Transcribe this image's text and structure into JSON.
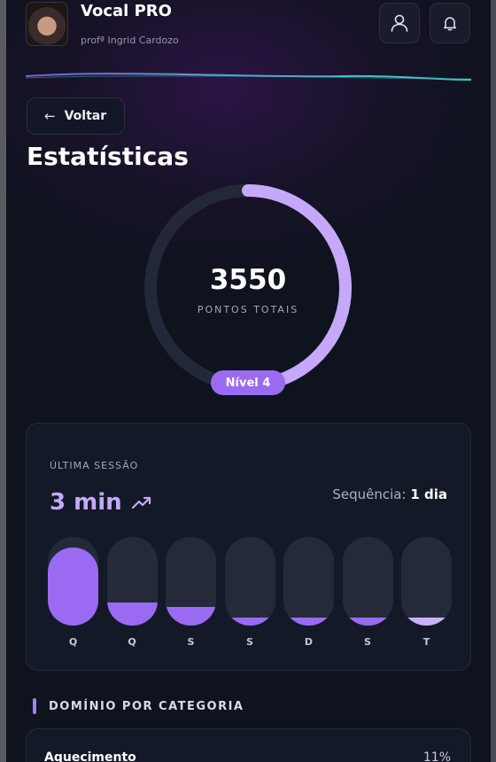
{
  "header": {
    "app_title": "Vocal PRO",
    "subtitle": "profª Ingrid Cardozo",
    "icons": [
      "profile-icon",
      "bell-icon"
    ]
  },
  "nav": {
    "back_label": "Voltar"
  },
  "page": {
    "title": "Estatísticas"
  },
  "points": {
    "value": "3550",
    "label": "PONTOS TOTAIS",
    "level": "Nível 4",
    "ring_progress": 0.46
  },
  "session": {
    "label": "ÚLTIMA SESSÃO",
    "duration": "3 min",
    "streak_label": "Sequência: ",
    "streak_value": "1 dia",
    "days": [
      {
        "label": "Q",
        "fill": 0.88
      },
      {
        "label": "Q",
        "fill": 0.26
      },
      {
        "label": "S",
        "fill": 0.21
      },
      {
        "label": "S",
        "fill": 0.09
      },
      {
        "label": "D",
        "fill": 0.09
      },
      {
        "label": "S",
        "fill": 0.09
      },
      {
        "label": "T",
        "fill": 0.09
      }
    ]
  },
  "categories": {
    "title": "DOMÍNIO POR CATEGORIA",
    "items": [
      {
        "name": "Aquecimento",
        "percent": "11%"
      }
    ]
  },
  "colors": {
    "accent": "#9a6bf2",
    "accent_light": "#c6a8fb",
    "background": "#0f131e",
    "card": "#141928"
  }
}
